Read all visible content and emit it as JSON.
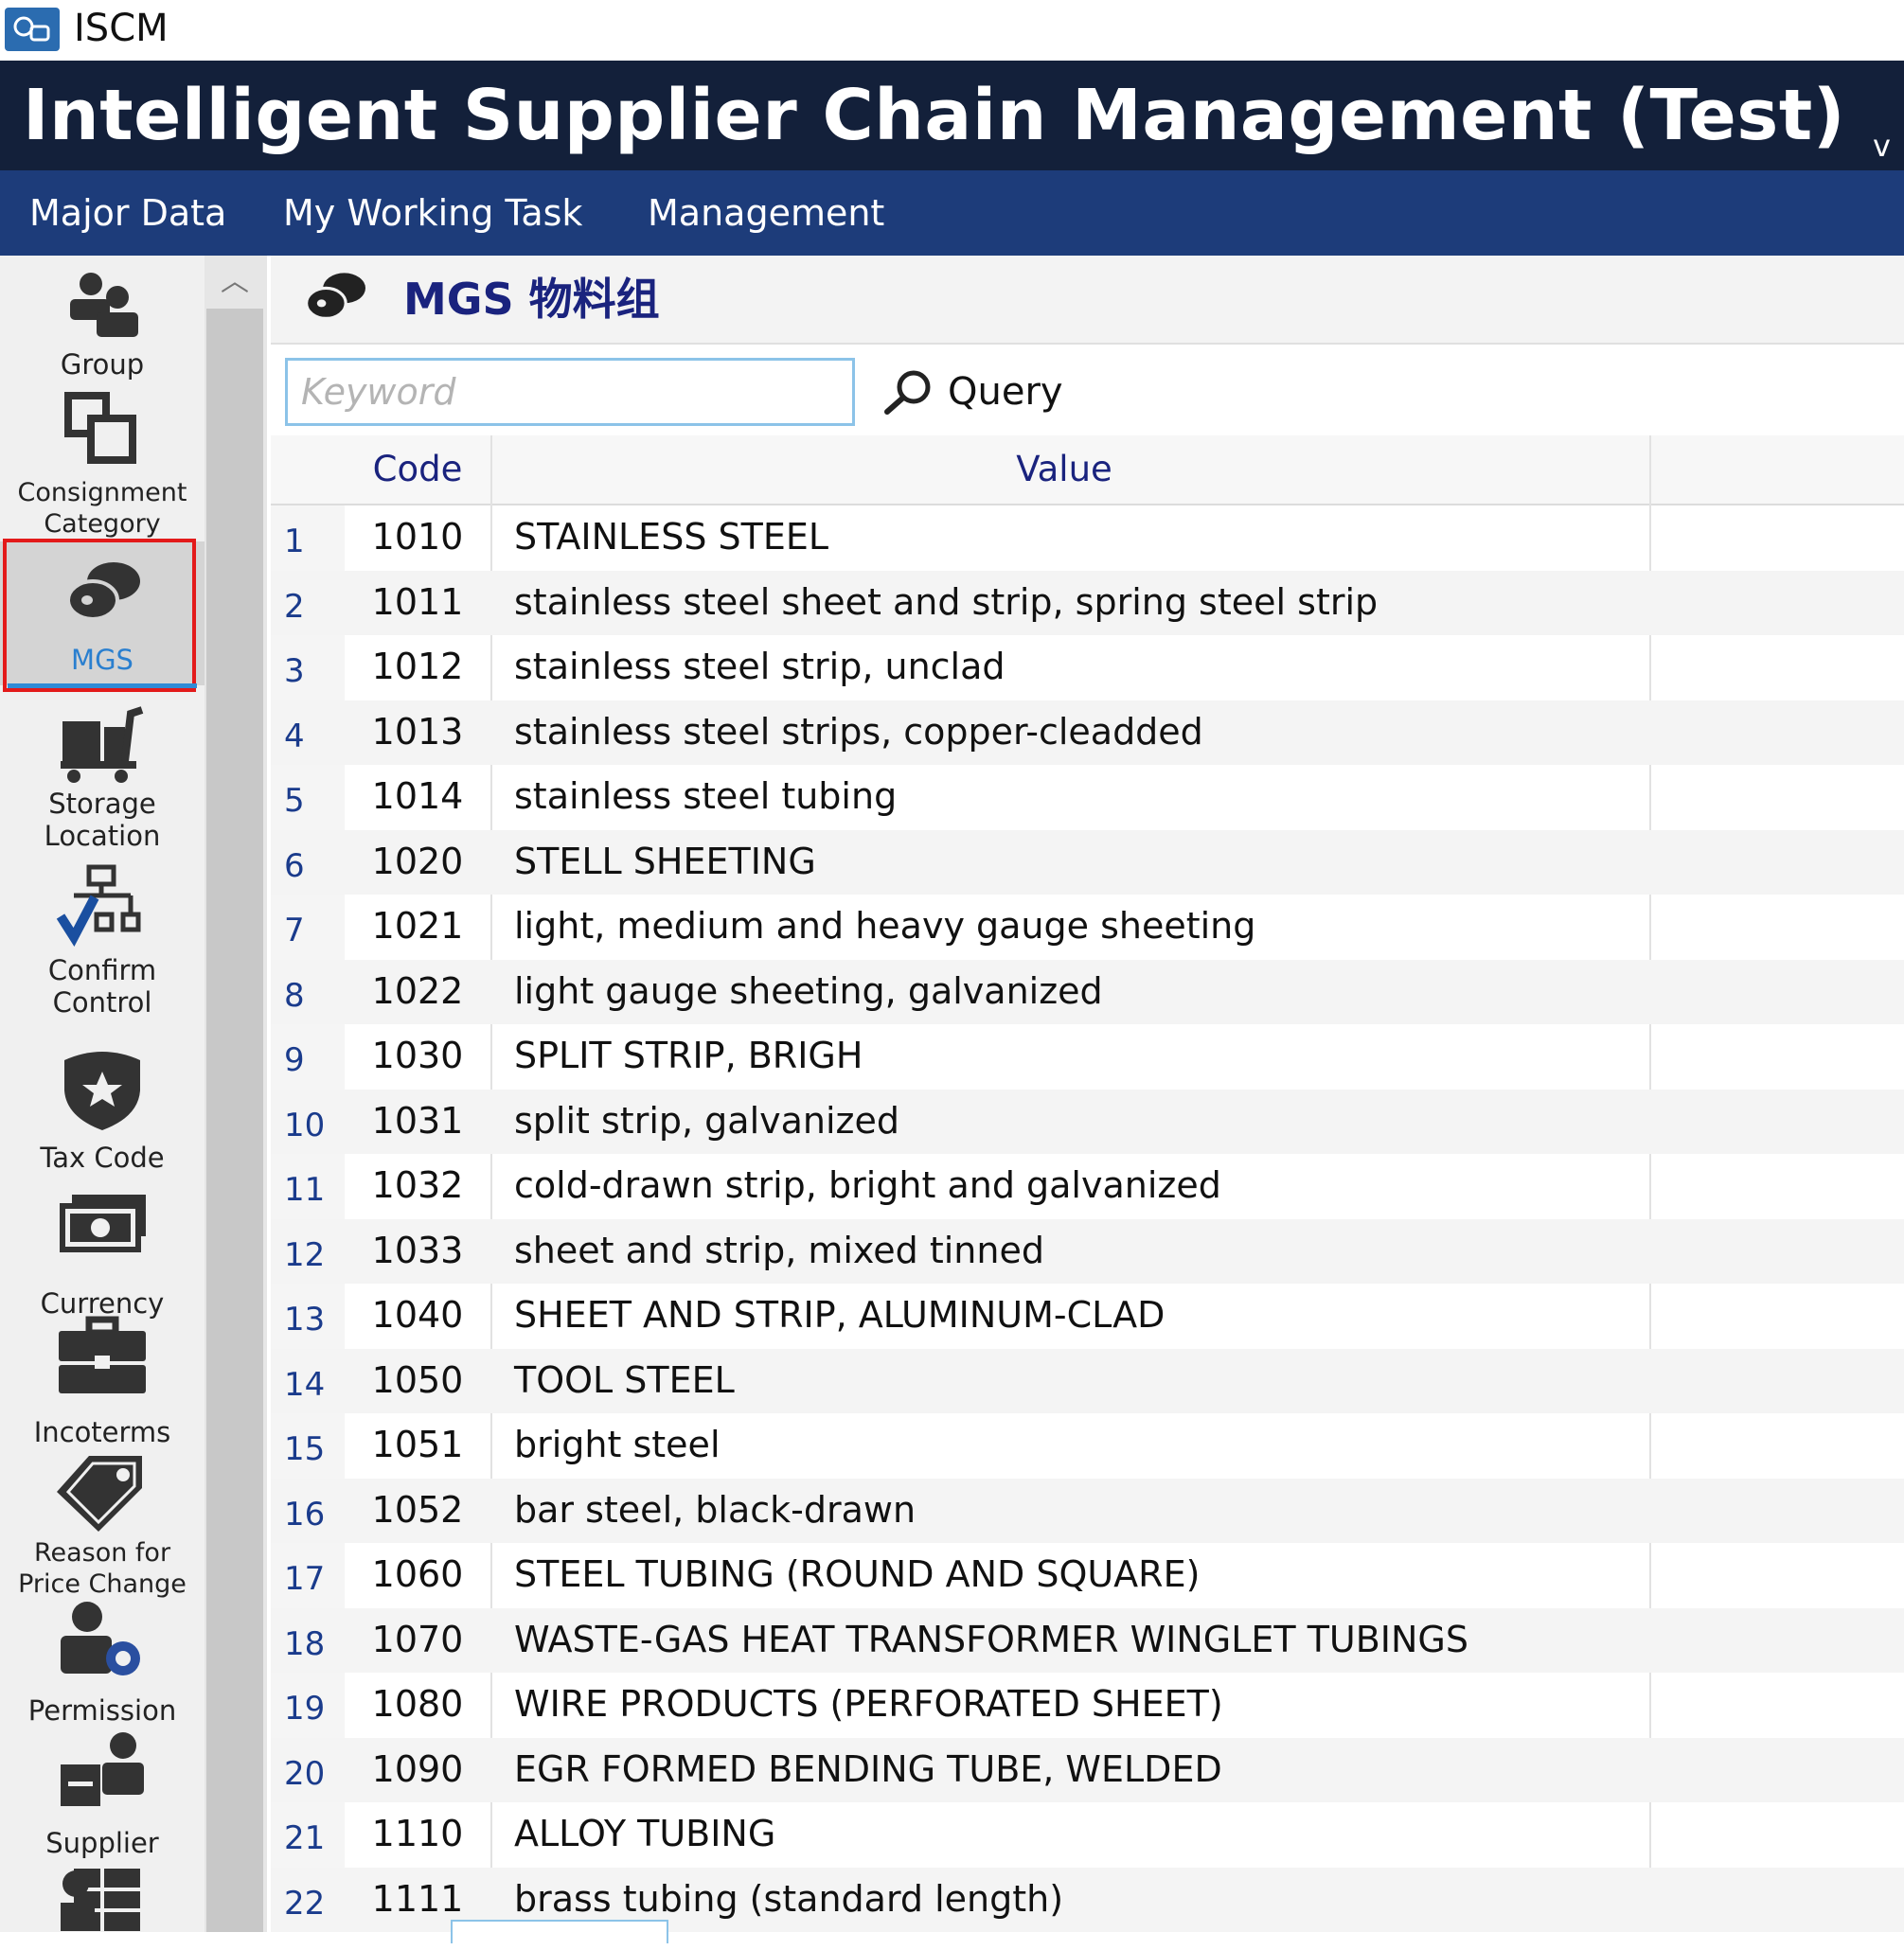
{
  "app": {
    "name": "ISCM",
    "icon": "app-logo-icon"
  },
  "banner": {
    "title": "Intelligent Supplier Chain Management (Test)",
    "chevron": "v"
  },
  "menu": [
    {
      "label": "Major Data"
    },
    {
      "label": "My Working Task"
    },
    {
      "label": "Management"
    }
  ],
  "sidebar": {
    "selected": "MGS",
    "items": [
      {
        "label": "Group",
        "icon": "group-icon"
      },
      {
        "label": "Consignment Category",
        "icon": "consignment-category-icon"
      },
      {
        "label": "MGS",
        "icon": "mgs-icon"
      },
      {
        "label": "Storage Location",
        "icon": "storage-location-icon"
      },
      {
        "label": "Confirm Control",
        "icon": "confirm-control-icon"
      },
      {
        "label": "Tax Code",
        "icon": "tax-code-icon"
      },
      {
        "label": "Currency",
        "icon": "currency-icon"
      },
      {
        "label": "Incoterms",
        "icon": "incoterms-icon"
      },
      {
        "label": "Reason for Price Change",
        "icon": "price-tag-icon"
      },
      {
        "label": "Permission",
        "icon": "permission-icon"
      },
      {
        "label": "Supplier",
        "icon": "supplier-icon"
      }
    ]
  },
  "page": {
    "title": "MGS 物料组",
    "icon": "mgs-icon"
  },
  "search": {
    "placeholder": "Keyword",
    "value": "",
    "button_label": "Query"
  },
  "table": {
    "columns": [
      "Code",
      "Value"
    ],
    "rows": [
      {
        "num": "1",
        "code": "1010",
        "value": "STAINLESS STEEL"
      },
      {
        "num": "2",
        "code": "1011",
        "value": "stainless steel sheet and strip, spring steel strip"
      },
      {
        "num": "3",
        "code": "1012",
        "value": "stainless steel strip, unclad"
      },
      {
        "num": "4",
        "code": "1013",
        "value": "stainless steel strips, copper-cleadded"
      },
      {
        "num": "5",
        "code": "1014",
        "value": "stainless steel tubing"
      },
      {
        "num": "6",
        "code": "1020",
        "value": "STELL SHEETING"
      },
      {
        "num": "7",
        "code": "1021",
        "value": "light, medium and heavy gauge sheeting"
      },
      {
        "num": "8",
        "code": "1022",
        "value": "light gauge sheeting, galvanized"
      },
      {
        "num": "9",
        "code": "1030",
        "value": "SPLIT STRIP, BRIGH"
      },
      {
        "num": "10",
        "code": "1031",
        "value": "split strip, galvanized"
      },
      {
        "num": "11",
        "code": "1032",
        "value": "cold-drawn strip, bright and galvanized"
      },
      {
        "num": "12",
        "code": "1033",
        "value": "sheet and strip, mixed tinned"
      },
      {
        "num": "13",
        "code": "1040",
        "value": "SHEET AND STRIP, ALUMINUM-CLAD"
      },
      {
        "num": "14",
        "code": "1050",
        "value": "TOOL STEEL"
      },
      {
        "num": "15",
        "code": "1051",
        "value": "bright steel"
      },
      {
        "num": "16",
        "code": "1052",
        "value": "bar steel, black-drawn"
      },
      {
        "num": "17",
        "code": "1060",
        "value": "STEEL TUBING (ROUND AND SQUARE)"
      },
      {
        "num": "18",
        "code": "1070",
        "value": "WASTE-GAS HEAT TRANSFORMER WINGLET TUBINGS"
      },
      {
        "num": "19",
        "code": "1080",
        "value": "WIRE PRODUCTS (PERFORATED SHEET)"
      },
      {
        "num": "20",
        "code": "1090",
        "value": "EGR FORMED BENDING TUBE, WELDED"
      },
      {
        "num": "21",
        "code": "1110",
        "value": "ALLOY TUBING"
      },
      {
        "num": "22",
        "code": "1111",
        "value": "brass tubing (standard length)"
      }
    ]
  },
  "colors": {
    "banner_bg": "#13203a",
    "menubar_bg": "#1d3c7a",
    "accent_text": "#1a237e",
    "selection_border": "#e31a1a",
    "selection_underline": "#2f8bd6",
    "input_border": "#8cc3e8"
  }
}
